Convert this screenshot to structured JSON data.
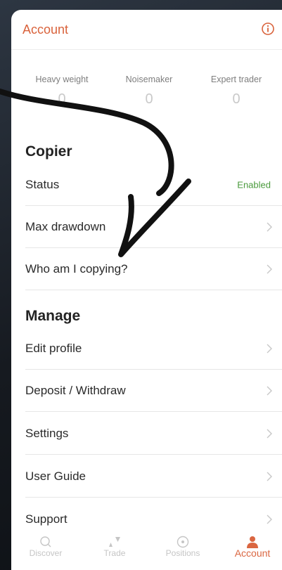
{
  "header": {
    "title": "Account",
    "info_icon": "info-icon"
  },
  "badges": [
    {
      "label": "Heavy weight",
      "value": "0"
    },
    {
      "label": "Noisemaker",
      "value": "0"
    },
    {
      "label": "Expert trader",
      "value": "0"
    }
  ],
  "copier": {
    "title": "Copier",
    "status_label": "Status",
    "status_value": "Enabled",
    "max_drawdown_label": "Max drawdown",
    "who_copying_label": "Who am I copying?"
  },
  "manage": {
    "title": "Manage",
    "items": [
      {
        "label": "Edit profile"
      },
      {
        "label": "Deposit / Withdraw"
      },
      {
        "label": "Settings"
      },
      {
        "label": "User Guide"
      },
      {
        "label": "Support"
      }
    ]
  },
  "tabbar": {
    "tabs": [
      {
        "label": "Discover",
        "icon": "search-icon"
      },
      {
        "label": "Trade",
        "icon": "trade-icon"
      },
      {
        "label": "Positions",
        "icon": "positions-icon"
      },
      {
        "label": "Account",
        "icon": "person-icon"
      }
    ],
    "active": "Account"
  },
  "colors": {
    "accent": "#d9623b",
    "enabled": "#4a9a3c"
  }
}
